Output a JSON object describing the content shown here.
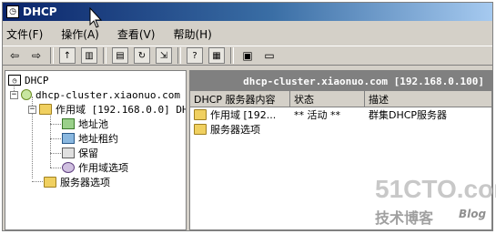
{
  "window": {
    "title": "DHCP",
    "title_icon": "dhcp-console-icon"
  },
  "menubar": [
    "文件(F)",
    "操作(A)",
    "查看(V)",
    "帮助(H)"
  ],
  "toolbar_icons": [
    "back-arrow-icon",
    "forward-arrow-icon",
    "up-folder-icon",
    "show-hide-tree-icon",
    "properties-icon",
    "refresh-icon",
    "export-list-icon",
    "help-icon",
    "console-tree-icon",
    "server-icon",
    "monitor-icon"
  ],
  "tree": {
    "root": "DHCP",
    "server": "dhcp-cluster.xiaonuo.com",
    "scope": "作用域 [192.168.0.0] DH",
    "items": [
      "地址池",
      "地址租约",
      "保留",
      "作用域选项"
    ],
    "server_options": "服务器选项"
  },
  "right_pane": {
    "header": "dhcp-cluster.xiaonuo.com [192.168.0.100]",
    "columns": [
      "DHCP 服务器内容",
      "状态",
      "描述"
    ],
    "rows": [
      {
        "name": "作用域 [192...",
        "status": "** 活动 **",
        "desc": "群集DHCP服务器"
      },
      {
        "name": "服务器选项",
        "status": "",
        "desc": ""
      }
    ]
  },
  "watermark": {
    "main": "51CTO.com",
    "sub": "技术博客",
    "blog": "Blog"
  }
}
